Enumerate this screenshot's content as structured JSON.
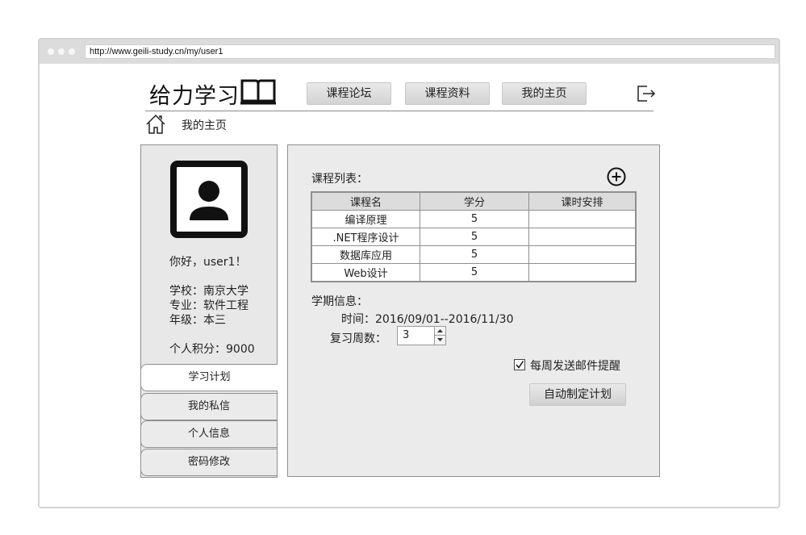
{
  "browser": {
    "url": "http://www.geili-study.cn/my/user1"
  },
  "header": {
    "logo_text": "给力学习",
    "nav": [
      {
        "label": "课程论坛"
      },
      {
        "label": "课程资料"
      },
      {
        "label": "我的主页"
      }
    ],
    "breadcrumb": "我的主页"
  },
  "profile": {
    "greeting": "你好，user1！",
    "school": "学校：南京大学",
    "major": "专业：软件工程",
    "grade": "年级：本三",
    "points": "个人积分：9000"
  },
  "tabs": [
    {
      "label": "学习计划",
      "active": true
    },
    {
      "label": "我的私信",
      "active": false
    },
    {
      "label": "个人信息",
      "active": false
    },
    {
      "label": "密码修改",
      "active": false
    }
  ],
  "courses": {
    "label": "课程列表：",
    "columns": [
      "课程名",
      "学分",
      "课时安排"
    ],
    "rows": [
      [
        "编译原理",
        "5",
        ""
      ],
      [
        ".NET程序设计",
        "5",
        ""
      ],
      [
        "数据库应用",
        "5",
        ""
      ],
      [
        "Web设计",
        "5",
        ""
      ]
    ]
  },
  "term": {
    "label": "学期信息：",
    "time": "时间：2016/09/01--2016/11/30",
    "review_weeks_label": "复习周数：",
    "review_weeks_value": "3"
  },
  "email_reminder": {
    "label": "每周发送邮件提醒",
    "checked": true
  },
  "auto_plan_label": "自动制定计划",
  "icons": [
    "home-icon",
    "book-icon",
    "exit-icon",
    "avatar-icon",
    "add-icon",
    "spinner-up-icon",
    "spinner-down-icon",
    "checkbox-check-icon"
  ]
}
